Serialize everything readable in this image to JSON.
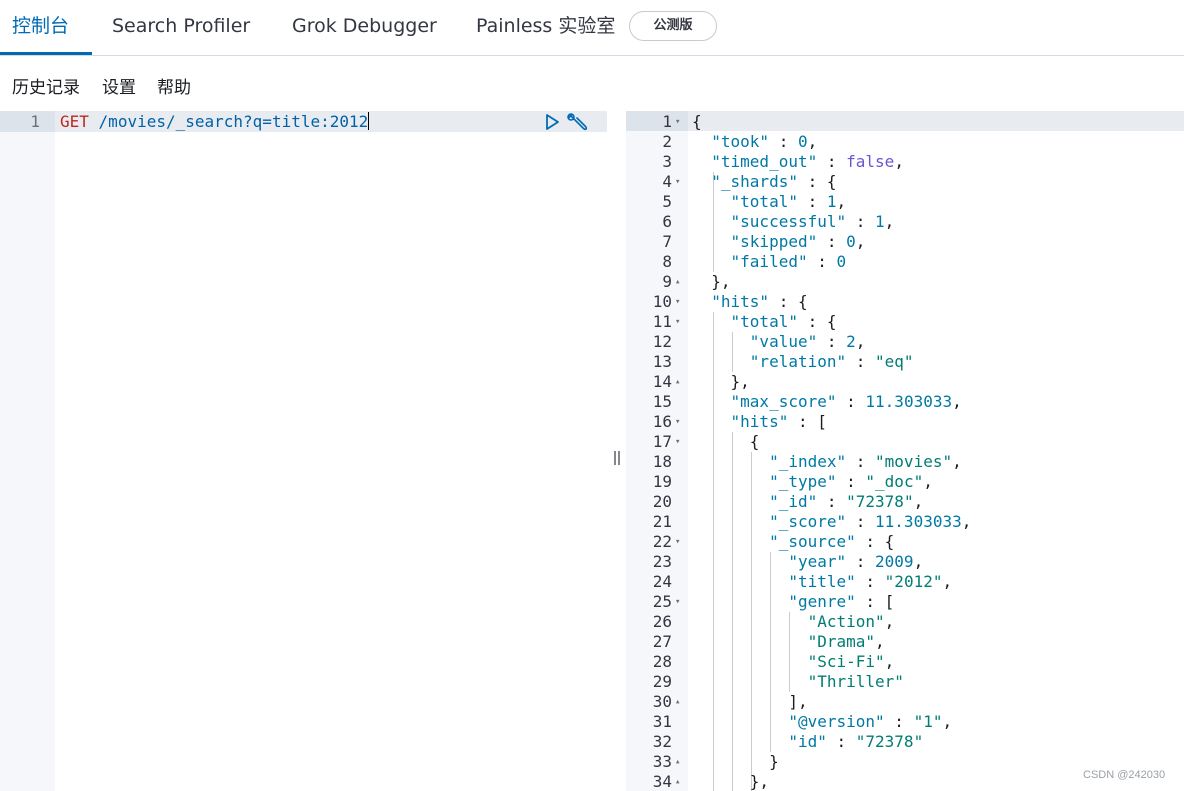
{
  "tabs": [
    {
      "label": "控制台",
      "active": true
    },
    {
      "label": "Search Profiler",
      "active": false
    },
    {
      "label": "Grok Debugger",
      "active": false
    },
    {
      "label": "Painless 实验室",
      "active": false
    }
  ],
  "beta_badge": "公测版",
  "submenu": {
    "history": "历史记录",
    "settings": "设置",
    "help": "帮助"
  },
  "request": {
    "line_number": "1",
    "method": "GET",
    "url": "/movies/_search?q=title:2012"
  },
  "response_lines": [
    {
      "n": "1",
      "fold": "▾",
      "html": "{"
    },
    {
      "n": "2",
      "fold": "",
      "html": "  <span class='k'>\"took\"</span> : <span class='n'>0</span>,"
    },
    {
      "n": "3",
      "fold": "",
      "html": "  <span class='k'>\"timed_out\"</span> : <span class='b'>false</span>,"
    },
    {
      "n": "4",
      "fold": "▾",
      "html": "  <span class='k'>\"_shards\"</span> : {"
    },
    {
      "n": "5",
      "fold": "",
      "html": "    <span class='k'>\"total\"</span> : <span class='n'>1</span>,"
    },
    {
      "n": "6",
      "fold": "",
      "html": "    <span class='k'>\"successful\"</span> : <span class='n'>1</span>,"
    },
    {
      "n": "7",
      "fold": "",
      "html": "    <span class='k'>\"skipped\"</span> : <span class='n'>0</span>,"
    },
    {
      "n": "8",
      "fold": "",
      "html": "    <span class='k'>\"failed\"</span> : <span class='n'>0</span>"
    },
    {
      "n": "9",
      "fold": "▴",
      "html": "  },"
    },
    {
      "n": "10",
      "fold": "▾",
      "html": "  <span class='k'>\"hits\"</span> : {"
    },
    {
      "n": "11",
      "fold": "▾",
      "html": "    <span class='k'>\"total\"</span> : {"
    },
    {
      "n": "12",
      "fold": "",
      "html": "      <span class='k'>\"value\"</span> : <span class='n'>2</span>,"
    },
    {
      "n": "13",
      "fold": "",
      "html": "      <span class='k'>\"relation\"</span> : <span class='s'>\"eq\"</span>"
    },
    {
      "n": "14",
      "fold": "▴",
      "html": "    },"
    },
    {
      "n": "15",
      "fold": "",
      "html": "    <span class='k'>\"max_score\"</span> : <span class='n'>11.303033</span>,"
    },
    {
      "n": "16",
      "fold": "▾",
      "html": "    <span class='k'>\"hits\"</span> : ["
    },
    {
      "n": "17",
      "fold": "▾",
      "html": "      {"
    },
    {
      "n": "18",
      "fold": "",
      "html": "        <span class='k'>\"_index\"</span> : <span class='s'>\"movies\"</span>,"
    },
    {
      "n": "19",
      "fold": "",
      "html": "        <span class='k'>\"_type\"</span> : <span class='s'>\"_doc\"</span>,"
    },
    {
      "n": "20",
      "fold": "",
      "html": "        <span class='k'>\"_id\"</span> : <span class='s'>\"72378\"</span>,"
    },
    {
      "n": "21",
      "fold": "",
      "html": "        <span class='k'>\"_score\"</span> : <span class='n'>11.303033</span>,"
    },
    {
      "n": "22",
      "fold": "▾",
      "html": "        <span class='k'>\"_source\"</span> : {"
    },
    {
      "n": "23",
      "fold": "",
      "html": "          <span class='k'>\"year\"</span> : <span class='n'>2009</span>,"
    },
    {
      "n": "24",
      "fold": "",
      "html": "          <span class='k'>\"title\"</span> : <span class='s'>\"2012\"</span>,"
    },
    {
      "n": "25",
      "fold": "▾",
      "html": "          <span class='k'>\"genre\"</span> : ["
    },
    {
      "n": "26",
      "fold": "",
      "html": "            <span class='s'>\"Action\"</span>,"
    },
    {
      "n": "27",
      "fold": "",
      "html": "            <span class='s'>\"Drama\"</span>,"
    },
    {
      "n": "28",
      "fold": "",
      "html": "            <span class='s'>\"Sci-Fi\"</span>,"
    },
    {
      "n": "29",
      "fold": "",
      "html": "            <span class='s'>\"Thriller\"</span>"
    },
    {
      "n": "30",
      "fold": "▴",
      "html": "          ],"
    },
    {
      "n": "31",
      "fold": "",
      "html": "          <span class='k'>\"@version\"</span> : <span class='s'>\"1\"</span>,"
    },
    {
      "n": "32",
      "fold": "",
      "html": "          <span class='k'>\"id\"</span> : <span class='s'>\"72378\"</span>"
    },
    {
      "n": "33",
      "fold": "▴",
      "html": "        }"
    },
    {
      "n": "34",
      "fold": "▴",
      "html": "      },"
    }
  ],
  "watermark": "CSDN @242030",
  "colors": {
    "accent": "#006bb4",
    "method": "#bd271e",
    "key": "#0079a5",
    "string": "#017d73",
    "boolean": "#6c56cd"
  }
}
